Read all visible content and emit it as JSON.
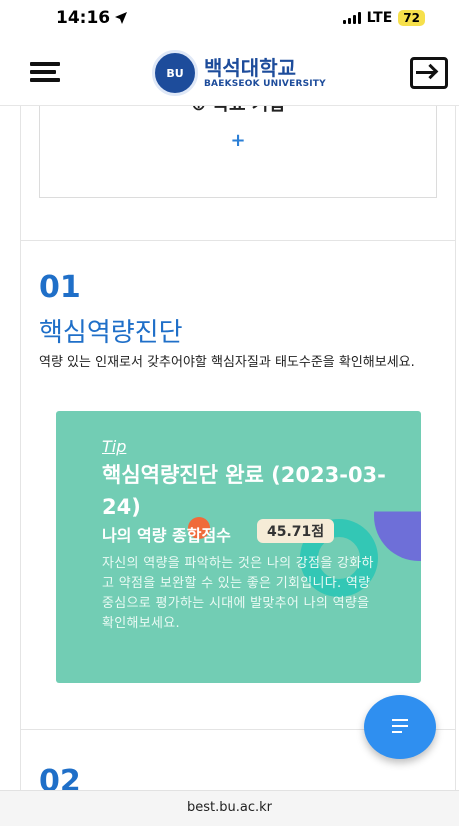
{
  "status_bar": {
    "time": "14:16",
    "network": "LTE",
    "battery": "72"
  },
  "header": {
    "logo_emblem": "BU",
    "logo_kr": "백석대학교",
    "logo_en": "BAEKSEOK UNIVERSITY"
  },
  "top_card": {
    "title": "⊕ 목표 기입",
    "plus": "+"
  },
  "section1": {
    "number": "01",
    "title": "핵심역량진단",
    "description": "역량 있는 인재로서 갖추어야할 핵심자질과 태도수준을 확인해보세요."
  },
  "tip_card": {
    "label": "Tip",
    "title": "핵심역량진단 완료 (2023-03-24)",
    "score_label": "나의 역량 종합점수",
    "score_value": "45.71점",
    "body": "자신의 역량을 파악하는 것은 나의 강점을 강화하고 약점을 보완할 수 있는 좋은 기회입니다. 역량 중심으로 평가하는 시대에 발맞추어 나의 역량을 확인해보세요."
  },
  "section2": {
    "number": "02"
  },
  "fab": {
    "icon": "document-lines-icon"
  },
  "url_bar": {
    "url": "best.bu.ac.kr"
  },
  "colors": {
    "primary_blue": "#1f6fc8",
    "tip_green": "#72cdb4",
    "fab_blue": "#2f8ff0",
    "battery_yellow": "#f6e04b"
  }
}
